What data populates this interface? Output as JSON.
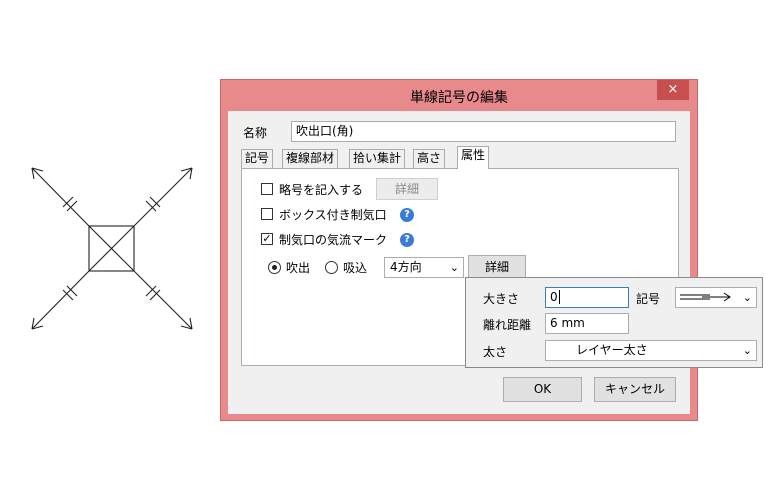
{
  "dialog": {
    "title": "単線記号の編集",
    "close_glyph": "×",
    "name_label": "名称",
    "name_value": "吹出口(角)",
    "tabs": [
      {
        "label": "記号"
      },
      {
        "label": "複線部材"
      },
      {
        "label": "拾い集計"
      },
      {
        "label": "高さ"
      },
      {
        "label": "属性"
      }
    ],
    "active_tab": "属性",
    "options": {
      "abbrev_label": "略号を記入する",
      "abbrev_checked": false,
      "abbrev_detail": "詳細",
      "box_damper_label": "ボックス付き制気口",
      "box_damper_checked": false,
      "airflow_mark_label": "制気口の気流マーク",
      "airflow_mark_checked": true,
      "help_glyph": "?",
      "radio_outlet": "吹出",
      "radio_inlet": "吸込",
      "selected_radio": "吹出",
      "direction_value": "4方向",
      "detail_button": "詳細"
    },
    "ok_label": "OK",
    "cancel_label": "キャンセル"
  },
  "popup": {
    "size_label": "大きさ",
    "size_value": "0",
    "symbol_label": "記号",
    "distance_label": "離れ距離",
    "distance_value": "6 mm",
    "thickness_label": "太さ",
    "thickness_value": "レイヤー太さ"
  },
  "icons": {
    "chevron": "⌄"
  }
}
